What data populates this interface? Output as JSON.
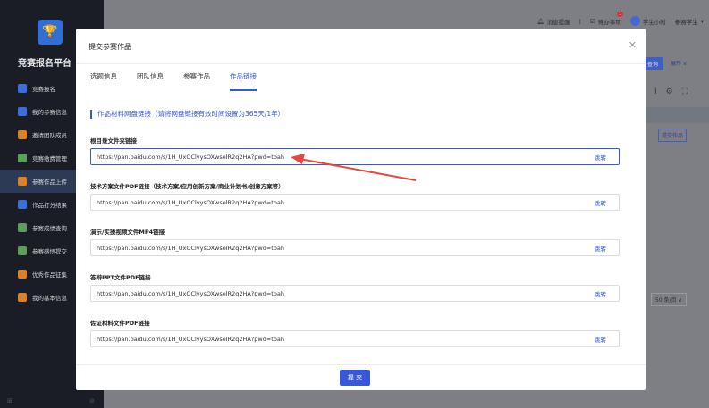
{
  "sidebar": {
    "brand": "竞赛报名平台",
    "items": [
      {
        "label": "竞赛报名",
        "color": "#3b6fd8"
      },
      {
        "label": "我的参赛信息",
        "color": "#3b6fd8"
      },
      {
        "label": "邀请团队成员",
        "color": "#d9822b"
      },
      {
        "label": "竞赛缴费管理",
        "color": "#5aa05a"
      },
      {
        "label": "参赛作品上传",
        "color": "#d9822b"
      },
      {
        "label": "作品打分结果",
        "color": "#3b6fd8"
      },
      {
        "label": "参赛成绩查询",
        "color": "#5aa05a"
      },
      {
        "label": "参赛感悟提交",
        "color": "#5aa05a"
      },
      {
        "label": "优秀作品征集",
        "color": "#d9822b"
      },
      {
        "label": "我的基本信息",
        "color": "#d9822b"
      }
    ]
  },
  "topbar": {
    "notifications": "消息提醒",
    "todo": "待办事项",
    "todo_badge": "1",
    "hours": "学生小时",
    "user": "参赛学生"
  },
  "background": {
    "query_label": "查询",
    "expand_label": "展开",
    "tag_label": "提交作品",
    "page_size": "50 条/页"
  },
  "modal": {
    "title": "提交参赛作品",
    "tabs": [
      "选题信息",
      "团队信息",
      "参赛作品",
      "作品链接"
    ],
    "active_tab_index": 3,
    "section_title": "作品材料网盘链接（请将网盘链接有效时间设置为365天/1年）",
    "jump_label": "跳转",
    "submit_label": "提 交",
    "fields": [
      {
        "label": "根目录文件夹链接",
        "value": "https://pan.baidu.com/s/1H_UxOClvysOXwselR2q2HA?pwd=tbah"
      },
      {
        "label": "技术方案文件PDF链接（技术方案/应用创新方案/商业计划书/创意方案等）",
        "value": "https://pan.baidu.com/s/1H_UxOClvysOXwselR2q2HA?pwd=tbah"
      },
      {
        "label": "演示/实操视频文件MP4链接",
        "value": "https://pan.baidu.com/s/1H_UxOClvysOXwselR2q2HA?pwd=tbah"
      },
      {
        "label": "答辩PPT文件PDF链接",
        "value": "https://pan.baidu.com/s/1H_UxOClvysOXwselR2q2HA?pwd=tbah"
      },
      {
        "label": "佐证材料文件PDF链接",
        "value": "https://pan.baidu.com/s/1H_UxOClvysOXwselR2q2HA?pwd=tbah"
      }
    ]
  },
  "colors": {
    "accent": "#3658d9",
    "annotation_arrow": "#e8473b"
  }
}
